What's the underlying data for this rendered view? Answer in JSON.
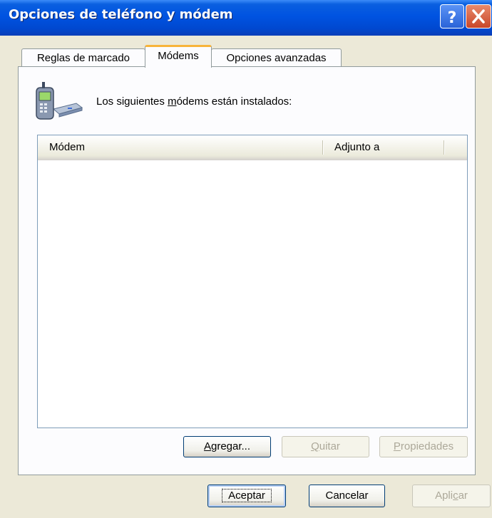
{
  "window": {
    "title": "Opciones de teléfono y módem",
    "help_glyph": "?",
    "close_glyph": "✕"
  },
  "tabs": [
    {
      "label": "Reglas de marcado",
      "selected": false
    },
    {
      "label": "Módems",
      "selected": true
    },
    {
      "label": "Opciones avanzadas",
      "selected": false
    }
  ],
  "modems_tab": {
    "icon": "phone-modem-icon",
    "intro_pre": "Los siguientes ",
    "intro_mnemonic": "m",
    "intro_post": "ódems están instalados:",
    "columns": [
      "Módem",
      "Adjunto a"
    ],
    "rows": [],
    "buttons": {
      "add": {
        "mnemonic": "A",
        "rest": "gregar...",
        "enabled": true
      },
      "remove": {
        "mnemonic": "Q",
        "rest": "uitar",
        "enabled": false
      },
      "properties": {
        "mnemonic": "P",
        "rest": "ropiedades",
        "enabled": false
      }
    }
  },
  "dialog_buttons": {
    "ok": {
      "pre": "",
      "mnemonic": "",
      "post": "Aceptar",
      "enabled": true
    },
    "cancel": {
      "pre": "",
      "mnemonic": "",
      "post": "Cancelar",
      "enabled": true
    },
    "apply": {
      "pre": "Apli",
      "mnemonic": "c",
      "post": "ar",
      "enabled": false
    }
  },
  "colors": {
    "titlebar": "#0053e1",
    "dialog_bg": "#ece9d8",
    "tab_highlight": "#f8b43a"
  }
}
